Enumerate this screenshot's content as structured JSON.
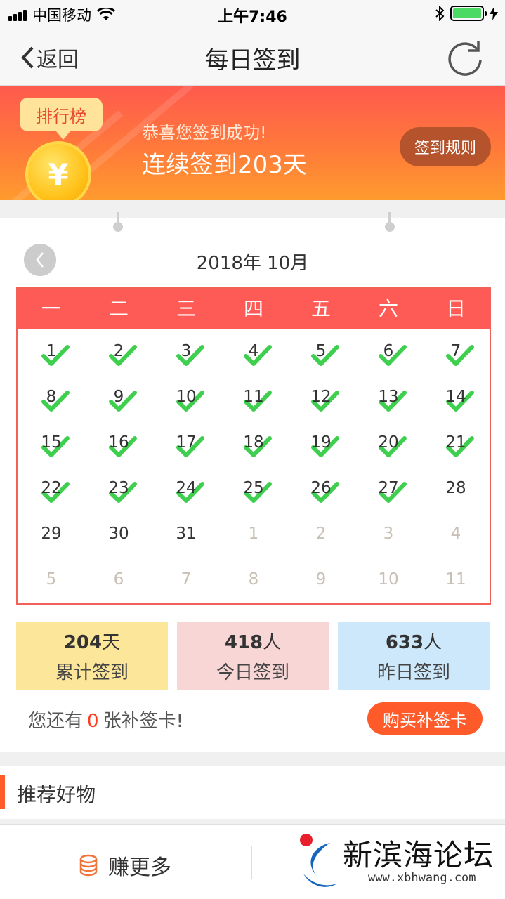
{
  "status_bar": {
    "carrier": "中国移动",
    "time": "上午7:46"
  },
  "nav": {
    "back_label": "返回",
    "title": "每日签到"
  },
  "banner": {
    "rank_label": "排行榜",
    "coin_symbol": "¥",
    "congrats": "恭喜您签到成功!",
    "streak": "连续签到203天",
    "rules_label": "签到规则"
  },
  "calendar": {
    "prev_symbol": "<",
    "month_label": "2018年 10月",
    "weekdays": [
      "一",
      "二",
      "三",
      "四",
      "五",
      "六",
      "日"
    ],
    "days": [
      {
        "d": "1",
        "checked": true,
        "other": false
      },
      {
        "d": "2",
        "checked": true,
        "other": false
      },
      {
        "d": "3",
        "checked": true,
        "other": false
      },
      {
        "d": "4",
        "checked": true,
        "other": false
      },
      {
        "d": "5",
        "checked": true,
        "other": false
      },
      {
        "d": "6",
        "checked": true,
        "other": false
      },
      {
        "d": "7",
        "checked": true,
        "other": false
      },
      {
        "d": "8",
        "checked": true,
        "other": false
      },
      {
        "d": "9",
        "checked": true,
        "other": false
      },
      {
        "d": "10",
        "checked": true,
        "other": false
      },
      {
        "d": "11",
        "checked": true,
        "other": false
      },
      {
        "d": "12",
        "checked": true,
        "other": false
      },
      {
        "d": "13",
        "checked": true,
        "other": false
      },
      {
        "d": "14",
        "checked": true,
        "other": false
      },
      {
        "d": "15",
        "checked": true,
        "other": false
      },
      {
        "d": "16",
        "checked": true,
        "other": false
      },
      {
        "d": "17",
        "checked": true,
        "other": false
      },
      {
        "d": "18",
        "checked": true,
        "other": false
      },
      {
        "d": "19",
        "checked": true,
        "other": false
      },
      {
        "d": "20",
        "checked": true,
        "other": false
      },
      {
        "d": "21",
        "checked": true,
        "other": false
      },
      {
        "d": "22",
        "checked": true,
        "other": false
      },
      {
        "d": "23",
        "checked": true,
        "other": false
      },
      {
        "d": "24",
        "checked": true,
        "other": false
      },
      {
        "d": "25",
        "checked": true,
        "other": false
      },
      {
        "d": "26",
        "checked": true,
        "other": false
      },
      {
        "d": "27",
        "checked": true,
        "other": false
      },
      {
        "d": "28",
        "checked": false,
        "other": false
      },
      {
        "d": "29",
        "checked": false,
        "other": false
      },
      {
        "d": "30",
        "checked": false,
        "other": false
      },
      {
        "d": "31",
        "checked": false,
        "other": false
      },
      {
        "d": "1",
        "checked": false,
        "other": true
      },
      {
        "d": "2",
        "checked": false,
        "other": true
      },
      {
        "d": "3",
        "checked": false,
        "other": true
      },
      {
        "d": "4",
        "checked": false,
        "other": true
      },
      {
        "d": "5",
        "checked": false,
        "other": true
      },
      {
        "d": "6",
        "checked": false,
        "other": true
      },
      {
        "d": "7",
        "checked": false,
        "other": true
      },
      {
        "d": "8",
        "checked": false,
        "other": true
      },
      {
        "d": "9",
        "checked": false,
        "other": true
      },
      {
        "d": "10",
        "checked": false,
        "other": true
      },
      {
        "d": "11",
        "checked": false,
        "other": true
      }
    ]
  },
  "stats": [
    {
      "num": "204",
      "unit": "天",
      "label": "累计签到"
    },
    {
      "num": "418",
      "unit": "人",
      "label": "今日签到"
    },
    {
      "num": "633",
      "unit": "人",
      "label": "昨日签到"
    }
  ],
  "makeup": {
    "prefix": "您还有",
    "count": "0",
    "suffix": "张补签卡!",
    "buy_label": "购买补签卡"
  },
  "recommend": {
    "title": "推荐好物"
  },
  "bottom": {
    "earn_label": "赚更多"
  },
  "watermark": {
    "name": "新滨海论坛",
    "url": "www.xbhwang.com"
  },
  "colors": {
    "accent": "#ff5b56",
    "check": "#3fcf4e",
    "orange": "#ff5a2a"
  }
}
